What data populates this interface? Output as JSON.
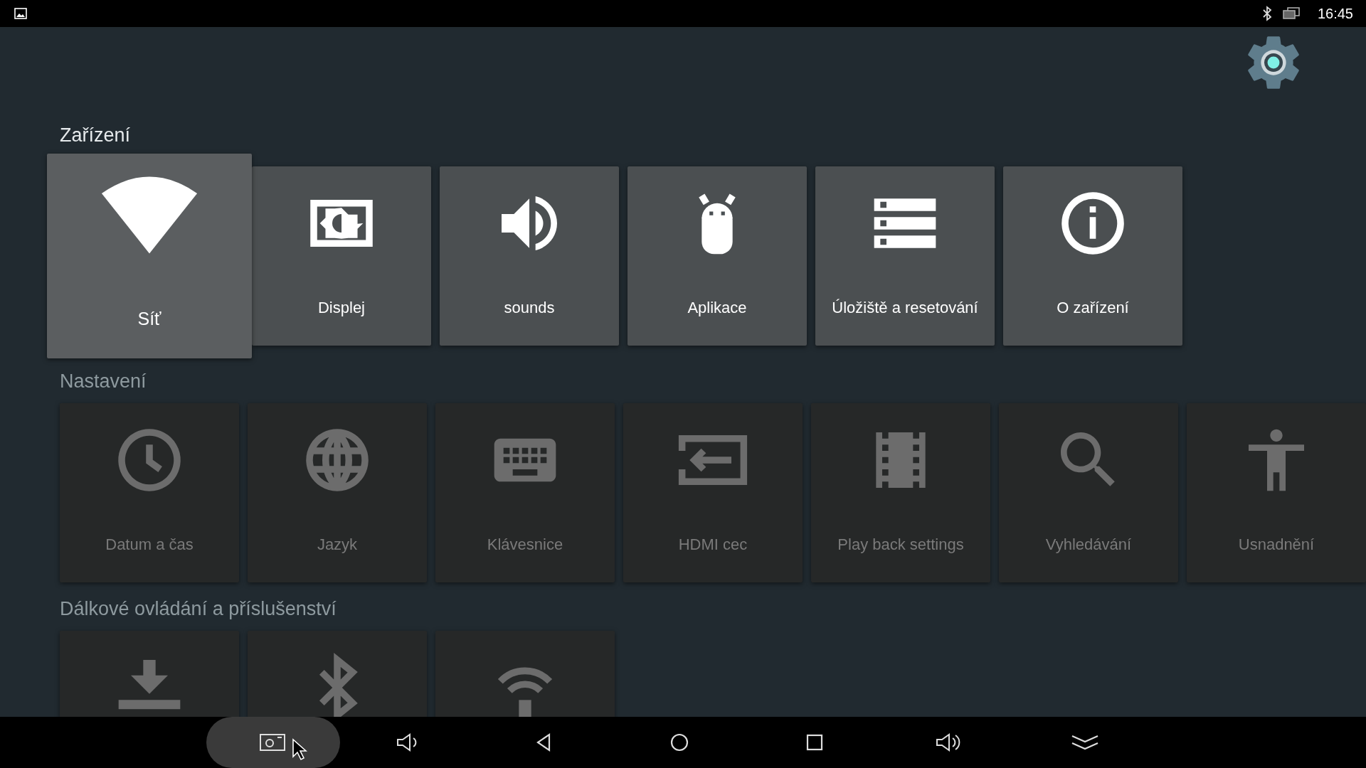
{
  "status_bar": {
    "time": "16:45"
  },
  "sections": [
    {
      "title": "Zařízení",
      "selected": true,
      "items": [
        {
          "label": "Síť",
          "selected": true
        },
        {
          "label": "Displej",
          "selected": false
        },
        {
          "label": "sounds",
          "selected": false
        },
        {
          "label": "Aplikace",
          "selected": false
        },
        {
          "label": "Úložiště a resetování",
          "selected": false
        },
        {
          "label": "O zařízení",
          "selected": false
        }
      ]
    },
    {
      "title": "Nastavení",
      "selected": false,
      "items": [
        {
          "label": "Datum a čas",
          "selected": false
        },
        {
          "label": "Jazyk",
          "selected": false
        },
        {
          "label": "Klávesnice",
          "selected": false
        },
        {
          "label": "HDMI cec",
          "selected": false
        },
        {
          "label": "Play back settings",
          "selected": false
        },
        {
          "label": "Vyhledávání",
          "selected": false
        },
        {
          "label": "Usnadnění",
          "selected": false
        }
      ]
    },
    {
      "title": "Dálkové ovládání a příslušenství",
      "selected": false,
      "items": [
        {
          "selected": false
        },
        {
          "selected": false
        },
        {
          "selected": false
        }
      ]
    }
  ],
  "nav_buttons": [
    {
      "selected": true
    },
    {
      "selected": false
    },
    {
      "selected": false
    },
    {
      "selected": false
    },
    {
      "selected": false
    },
    {
      "selected": false
    },
    {
      "selected": false
    }
  ]
}
